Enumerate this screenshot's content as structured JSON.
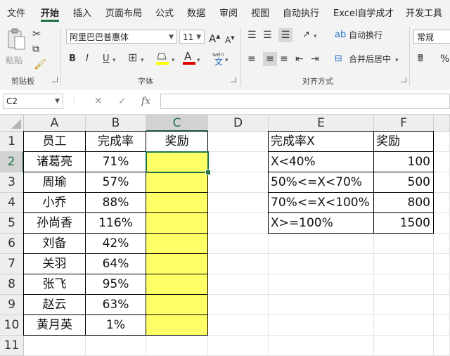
{
  "menu": {
    "items": [
      "文件",
      "开始",
      "插入",
      "页面布局",
      "公式",
      "数据",
      "审阅",
      "视图",
      "自动执行",
      "Excel自学成才",
      "开发工具"
    ],
    "active_index": 1
  },
  "ribbon": {
    "clipboard": {
      "paste_label": "粘贴",
      "group_label": "剪贴板"
    },
    "font": {
      "font_name": "阿里巴巴普惠体",
      "font_size": "11",
      "group_label": "字体",
      "wen_label": "wén",
      "wen_char": "文",
      "bold": "B",
      "italic": "I",
      "underline": "U",
      "grow": "A",
      "shrink": "A",
      "font_color": "A"
    },
    "alignment": {
      "wrap_label": "自动换行",
      "merge_label": "合并后居中",
      "group_label": "对齐方式"
    },
    "number": {
      "format": "常规",
      "percent": "%"
    }
  },
  "formula_bar": {
    "name_box": "C2",
    "fx": "fx",
    "cancel": "✕",
    "enter": "✓",
    "formula": ""
  },
  "colors": {
    "accent": "#217346",
    "highlight": "#ffff66"
  },
  "grid": {
    "columns": [
      "A",
      "B",
      "C",
      "D",
      "E",
      "F"
    ],
    "rows": [
      "1",
      "2",
      "3",
      "4",
      "5",
      "6",
      "7",
      "8",
      "9",
      "10",
      "11"
    ],
    "selected_cell": "C2",
    "main_table": {
      "headers": [
        "员工",
        "完成率",
        "奖励"
      ],
      "rows": [
        [
          "诸葛亮",
          "71%",
          ""
        ],
        [
          "周瑜",
          "57%",
          ""
        ],
        [
          "小乔",
          "88%",
          ""
        ],
        [
          "孙尚香",
          "116%",
          ""
        ],
        [
          "刘备",
          "42%",
          ""
        ],
        [
          "关羽",
          "64%",
          ""
        ],
        [
          "张飞",
          "95%",
          ""
        ],
        [
          "赵云",
          "63%",
          ""
        ],
        [
          "黄月英",
          "1%",
          ""
        ]
      ]
    },
    "lookup_table": {
      "headers": [
        "完成率X",
        "奖励"
      ],
      "rows": [
        [
          "X<40%",
          "100"
        ],
        [
          "50%<=X<70%",
          "500"
        ],
        [
          "70%<=X<100%",
          "800"
        ],
        [
          "X>=100%",
          "1500"
        ]
      ]
    }
  }
}
